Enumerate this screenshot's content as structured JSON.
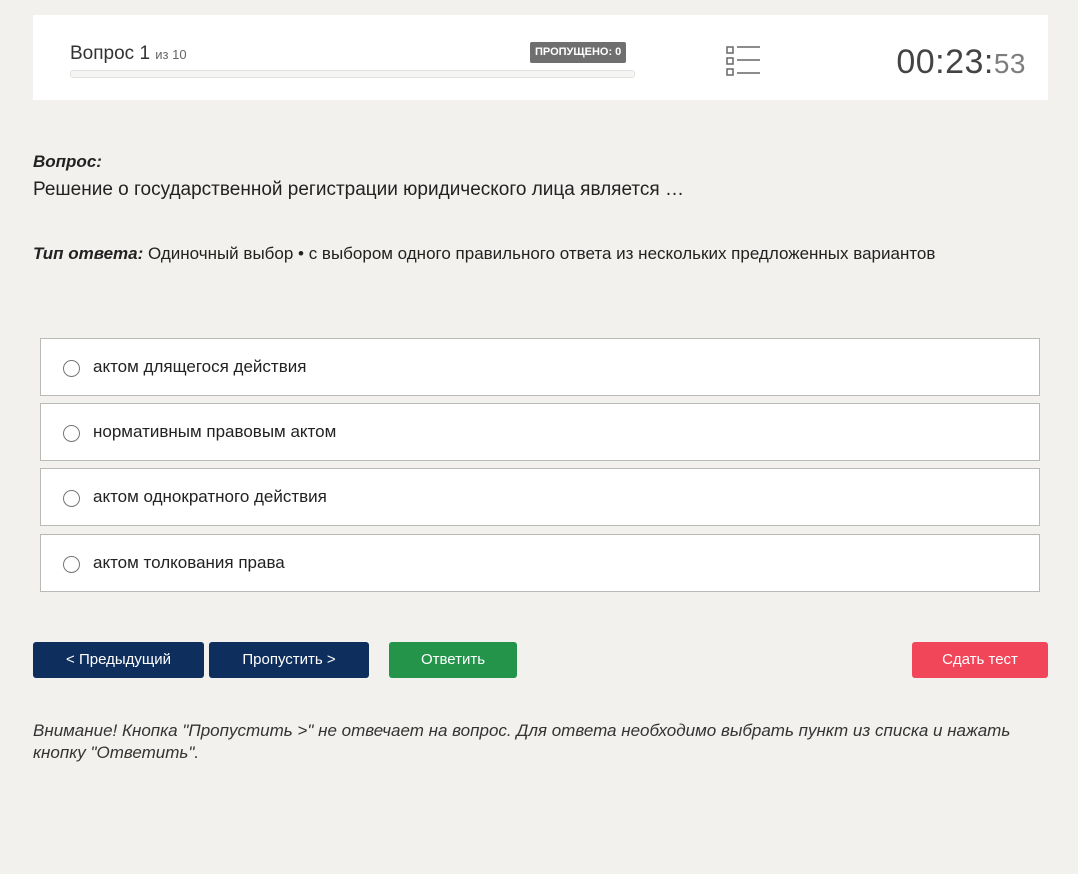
{
  "header": {
    "question_word": "Вопрос 1",
    "of_total": "из 10",
    "progress_fraction": 0,
    "skipped_badge": "ПРОПУЩЕНО: 0",
    "list_icon": "question-list-icon",
    "timer_main": "00:23:",
    "timer_seconds": "53"
  },
  "question": {
    "label": "Вопрос:",
    "text": "Решение о государственной регистрации юридического лица является …",
    "answer_type_label": "Тип ответа:",
    "answer_type_value": " Одиночный выбор • с выбором одного правильного ответа из нескольких предложенных вариантов"
  },
  "options": [
    {
      "label": "актом длящегося действия"
    },
    {
      "label": "нормативным правовым актом"
    },
    {
      "label": "актом однократного действия"
    },
    {
      "label": "актом толкования права"
    }
  ],
  "buttons": {
    "prev": "< Предыдущий",
    "skip": "Пропустить >",
    "answer": "Ответить",
    "finish": "Сдать тест"
  },
  "colors": {
    "nav_button": "#0e2f5e",
    "answer_button": "#23944a",
    "finish_button": "#f1465a",
    "badge": "#6f6f6f"
  },
  "warning": "Внимание! Кнопка \"Пропустить >\" не отвечает на вопрос. Для ответа необходимо выбрать пункт из списка и нажать кнопку \"Ответить\"."
}
